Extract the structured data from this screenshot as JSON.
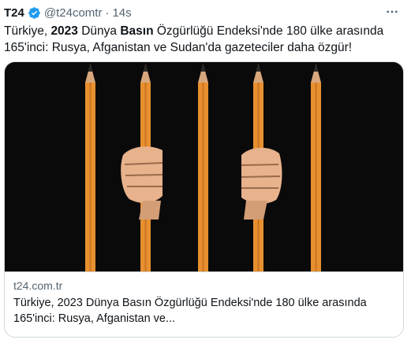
{
  "tweet": {
    "author_name": "T24",
    "handle": "@t24comtr",
    "separator": "·",
    "time": "14s",
    "text": {
      "p1": "Türkiye, ",
      "b1": "2023",
      "p2": " Dünya ",
      "b2": "Basın",
      "p3": " Özgürlüğü Endeksi'nde 180 ülke arasında 165'inci: Rusya, Afganistan ve Sudan'da gazeteciler daha özgür!"
    },
    "icons": {
      "verified": "verified-badge-icon",
      "more": "more-options-icon"
    }
  },
  "card": {
    "image": "prison-bars-of-pencils-with-hands",
    "domain": "t24.com.tr",
    "title_line1": "Türkiye, 2023 Dünya Basın Özgürlüğü Endeksi'nde 180 ülke arasında",
    "title_line2": "165'inci: Rusya, Afganistan ve..."
  },
  "colors": {
    "verified": "#1d9bf0",
    "secondary_text": "#536471",
    "border": "#cfd9de",
    "pencil": "#e8902f",
    "hand": "#e7b28c"
  }
}
